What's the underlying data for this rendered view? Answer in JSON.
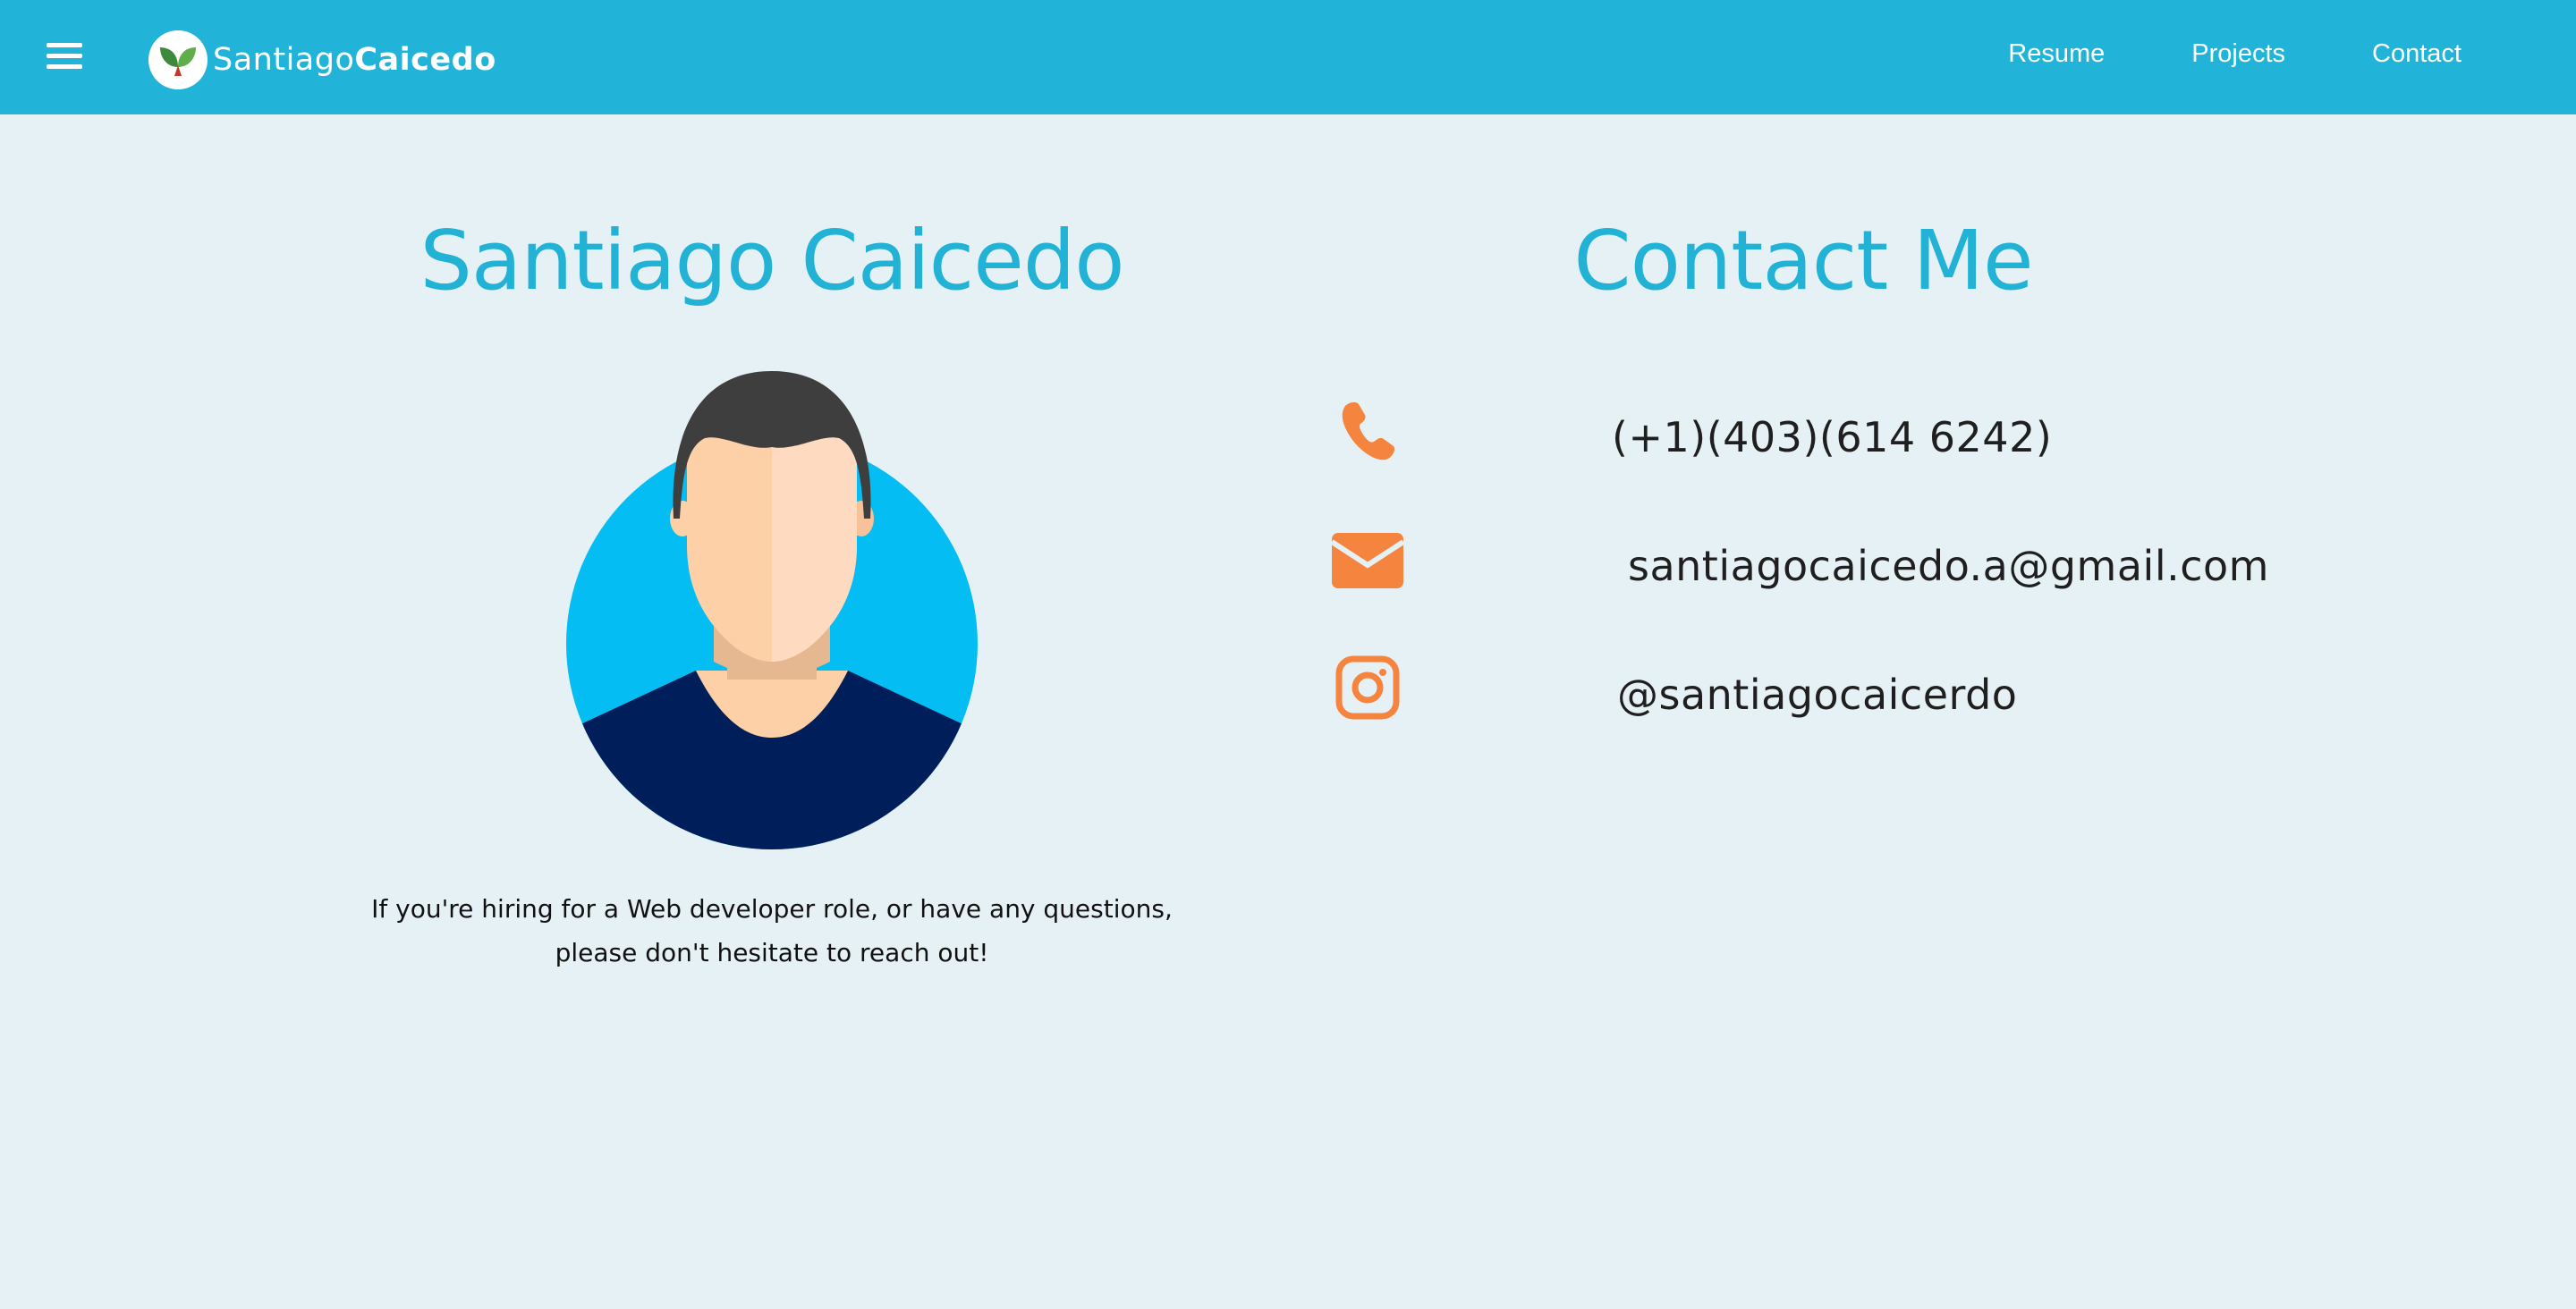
{
  "navbar": {
    "brand": {
      "first": "Santiago",
      "last": "Caicedo"
    },
    "links": [
      {
        "label": "Resume"
      },
      {
        "label": "Projects"
      },
      {
        "label": "Contact"
      }
    ]
  },
  "profile": {
    "name": "Santiago Caicedo",
    "bio_line1": "If you're hiring for a Web developer role, or have any questions,",
    "bio_line2": "please don't hesitate to reach out!"
  },
  "contact": {
    "title": "Contact Me",
    "items": [
      {
        "icon": "phone-icon",
        "text": "(+1)(403)(614 6242)"
      },
      {
        "icon": "envelope-icon",
        "text": "santiagocaicedo.a@gmail.com"
      },
      {
        "icon": "instagram-icon",
        "text": "@santiagocaicerdo"
      }
    ]
  },
  "colors": {
    "navbar": "#21b4d8",
    "background": "#e6f1f6",
    "heading": "#22b2d5",
    "icon_accent": "#f5843e"
  }
}
